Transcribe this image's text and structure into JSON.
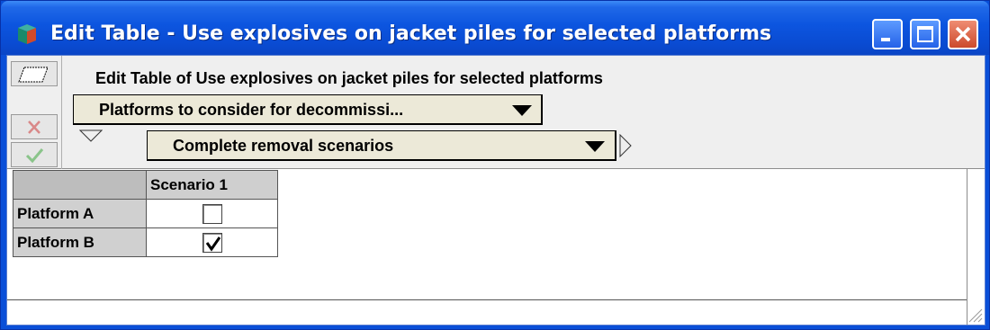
{
  "window": {
    "title": "Edit Table - Use explosives on jacket piles for selected platforms",
    "controls": {
      "minimize": "minimize-icon",
      "maximize": "maximize-icon",
      "close": "close-icon"
    }
  },
  "header": {
    "caption": "Edit Table of Use explosives on jacket piles for selected platforms"
  },
  "pivot": {
    "row_index": {
      "label": "Platforms to consider for decommissi...",
      "icon": "dropdown-arrow-icon"
    },
    "column_index": {
      "label": "Complete removal scenarios",
      "icon": "dropdown-arrow-icon"
    }
  },
  "table": {
    "columns": [
      "Scenario 1"
    ],
    "rows": [
      {
        "label": "Platform A",
        "values": [
          false
        ]
      },
      {
        "label": "Platform B",
        "values": [
          true
        ]
      }
    ]
  },
  "colors": {
    "titlebar": "#0a4fd8",
    "close_button": "#cc4a2c",
    "toolbar_bg": "#efefef",
    "dropdown_bg": "#ece9d8",
    "header_cell_bg": "#cfcfcf"
  }
}
